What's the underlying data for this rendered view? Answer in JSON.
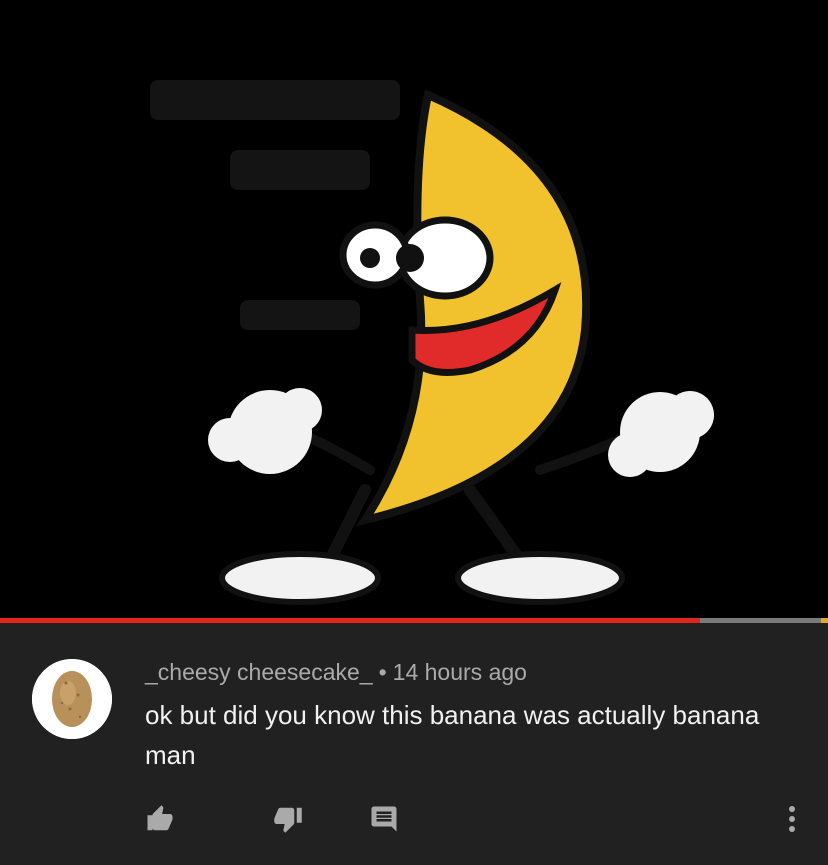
{
  "player": {
    "progress_fraction": 0.845
  },
  "comment": {
    "author": "_cheesy cheesecake_",
    "separator": "•",
    "time_ago": "14 hours ago",
    "text": "ok but did you know this banana was actually banana man"
  },
  "actions": {
    "like_icon": "thumb-up-icon",
    "dislike_icon": "thumb-down-icon",
    "reply_icon": "reply-icon",
    "more_icon": "more-vertical-icon"
  },
  "colors": {
    "progress_played": "#e1251b",
    "background": "#212121",
    "author_text": "#aaaaaa",
    "comment_text": "#f1f1f1"
  }
}
